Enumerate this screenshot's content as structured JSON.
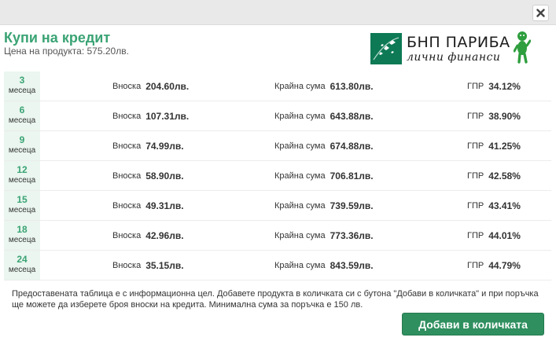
{
  "header": {
    "close_icon": "close-icon"
  },
  "title": "Купи на кредит",
  "price_line": "Цена на продукта: 575.20лв.",
  "logo": {
    "name": "БНП ПАРИБА",
    "tagline": "лични финанси",
    "color": "#0d7a55"
  },
  "labels": {
    "installment": "Вноска",
    "total": "Крайна сума",
    "apr": "ГПР"
  },
  "rows": [
    {
      "months": "3",
      "unit": "месеца",
      "installment": "204.60лв.",
      "total": "613.80лв.",
      "apr": "34.12%"
    },
    {
      "months": "6",
      "unit": "месеца",
      "installment": "107.31лв.",
      "total": "643.88лв.",
      "apr": "38.90%"
    },
    {
      "months": "9",
      "unit": "месеца",
      "installment": "74.99лв.",
      "total": "674.88лв.",
      "apr": "41.25%"
    },
    {
      "months": "12",
      "unit": "месеца",
      "installment": "58.90лв.",
      "total": "706.81лв.",
      "apr": "42.58%"
    },
    {
      "months": "15",
      "unit": "месеца",
      "installment": "49.31лв.",
      "total": "739.59лв.",
      "apr": "43.41%"
    },
    {
      "months": "18",
      "unit": "месеца",
      "installment": "42.96лв.",
      "total": "773.36лв.",
      "apr": "44.01%"
    },
    {
      "months": "24",
      "unit": "месеца",
      "installment": "35.15лв.",
      "total": "843.59лв.",
      "apr": "44.79%"
    }
  ],
  "note": "Предоставената таблица е с информационна цел. Добавете продукта в количката си с бутона \"Добави в количката\" и при поръчка ще можете да изберете броя вноски на кредита. Минимална сума за поръчка е 150 лв.",
  "add_button": "Добави в количката",
  "colors": {
    "accent": "#3aa374",
    "button": "#2f8f5f",
    "term_bg": "#eaf6ef"
  }
}
